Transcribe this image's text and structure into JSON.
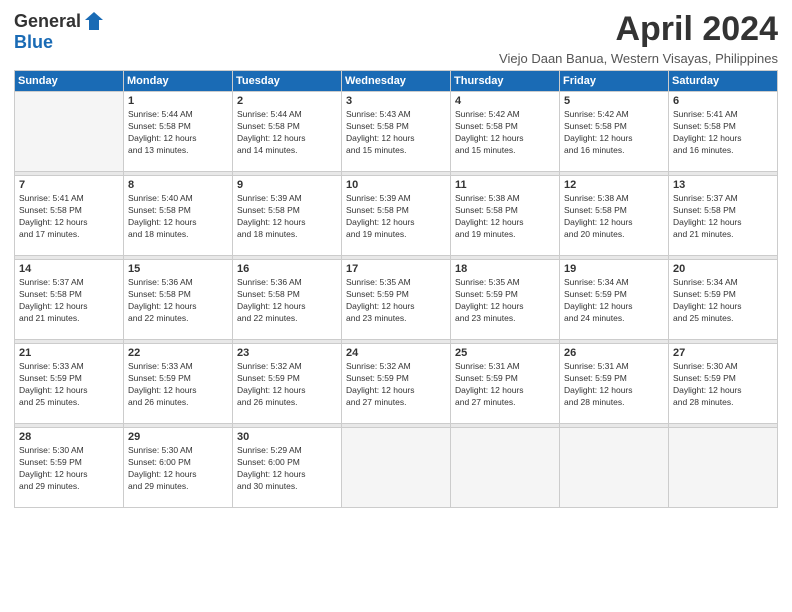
{
  "logo": {
    "general": "General",
    "blue": "Blue"
  },
  "title": "April 2024",
  "location": "Viejo Daan Banua, Western Visayas, Philippines",
  "days_of_week": [
    "Sunday",
    "Monday",
    "Tuesday",
    "Wednesday",
    "Thursday",
    "Friday",
    "Saturday"
  ],
  "weeks": [
    [
      {
        "day": "",
        "info": ""
      },
      {
        "day": "1",
        "info": "Sunrise: 5:44 AM\nSunset: 5:58 PM\nDaylight: 12 hours\nand 13 minutes."
      },
      {
        "day": "2",
        "info": "Sunrise: 5:44 AM\nSunset: 5:58 PM\nDaylight: 12 hours\nand 14 minutes."
      },
      {
        "day": "3",
        "info": "Sunrise: 5:43 AM\nSunset: 5:58 PM\nDaylight: 12 hours\nand 15 minutes."
      },
      {
        "day": "4",
        "info": "Sunrise: 5:42 AM\nSunset: 5:58 PM\nDaylight: 12 hours\nand 15 minutes."
      },
      {
        "day": "5",
        "info": "Sunrise: 5:42 AM\nSunset: 5:58 PM\nDaylight: 12 hours\nand 16 minutes."
      },
      {
        "day": "6",
        "info": "Sunrise: 5:41 AM\nSunset: 5:58 PM\nDaylight: 12 hours\nand 16 minutes."
      }
    ],
    [
      {
        "day": "7",
        "info": "Sunrise: 5:41 AM\nSunset: 5:58 PM\nDaylight: 12 hours\nand 17 minutes."
      },
      {
        "day": "8",
        "info": "Sunrise: 5:40 AM\nSunset: 5:58 PM\nDaylight: 12 hours\nand 18 minutes."
      },
      {
        "day": "9",
        "info": "Sunrise: 5:39 AM\nSunset: 5:58 PM\nDaylight: 12 hours\nand 18 minutes."
      },
      {
        "day": "10",
        "info": "Sunrise: 5:39 AM\nSunset: 5:58 PM\nDaylight: 12 hours\nand 19 minutes."
      },
      {
        "day": "11",
        "info": "Sunrise: 5:38 AM\nSunset: 5:58 PM\nDaylight: 12 hours\nand 19 minutes."
      },
      {
        "day": "12",
        "info": "Sunrise: 5:38 AM\nSunset: 5:58 PM\nDaylight: 12 hours\nand 20 minutes."
      },
      {
        "day": "13",
        "info": "Sunrise: 5:37 AM\nSunset: 5:58 PM\nDaylight: 12 hours\nand 21 minutes."
      }
    ],
    [
      {
        "day": "14",
        "info": "Sunrise: 5:37 AM\nSunset: 5:58 PM\nDaylight: 12 hours\nand 21 minutes."
      },
      {
        "day": "15",
        "info": "Sunrise: 5:36 AM\nSunset: 5:58 PM\nDaylight: 12 hours\nand 22 minutes."
      },
      {
        "day": "16",
        "info": "Sunrise: 5:36 AM\nSunset: 5:58 PM\nDaylight: 12 hours\nand 22 minutes."
      },
      {
        "day": "17",
        "info": "Sunrise: 5:35 AM\nSunset: 5:59 PM\nDaylight: 12 hours\nand 23 minutes."
      },
      {
        "day": "18",
        "info": "Sunrise: 5:35 AM\nSunset: 5:59 PM\nDaylight: 12 hours\nand 23 minutes."
      },
      {
        "day": "19",
        "info": "Sunrise: 5:34 AM\nSunset: 5:59 PM\nDaylight: 12 hours\nand 24 minutes."
      },
      {
        "day": "20",
        "info": "Sunrise: 5:34 AM\nSunset: 5:59 PM\nDaylight: 12 hours\nand 25 minutes."
      }
    ],
    [
      {
        "day": "21",
        "info": "Sunrise: 5:33 AM\nSunset: 5:59 PM\nDaylight: 12 hours\nand 25 minutes."
      },
      {
        "day": "22",
        "info": "Sunrise: 5:33 AM\nSunset: 5:59 PM\nDaylight: 12 hours\nand 26 minutes."
      },
      {
        "day": "23",
        "info": "Sunrise: 5:32 AM\nSunset: 5:59 PM\nDaylight: 12 hours\nand 26 minutes."
      },
      {
        "day": "24",
        "info": "Sunrise: 5:32 AM\nSunset: 5:59 PM\nDaylight: 12 hours\nand 27 minutes."
      },
      {
        "day": "25",
        "info": "Sunrise: 5:31 AM\nSunset: 5:59 PM\nDaylight: 12 hours\nand 27 minutes."
      },
      {
        "day": "26",
        "info": "Sunrise: 5:31 AM\nSunset: 5:59 PM\nDaylight: 12 hours\nand 28 minutes."
      },
      {
        "day": "27",
        "info": "Sunrise: 5:30 AM\nSunset: 5:59 PM\nDaylight: 12 hours\nand 28 minutes."
      }
    ],
    [
      {
        "day": "28",
        "info": "Sunrise: 5:30 AM\nSunset: 5:59 PM\nDaylight: 12 hours\nand 29 minutes."
      },
      {
        "day": "29",
        "info": "Sunrise: 5:30 AM\nSunset: 6:00 PM\nDaylight: 12 hours\nand 29 minutes."
      },
      {
        "day": "30",
        "info": "Sunrise: 5:29 AM\nSunset: 6:00 PM\nDaylight: 12 hours\nand 30 minutes."
      },
      {
        "day": "",
        "info": ""
      },
      {
        "day": "",
        "info": ""
      },
      {
        "day": "",
        "info": ""
      },
      {
        "day": "",
        "info": ""
      }
    ]
  ]
}
